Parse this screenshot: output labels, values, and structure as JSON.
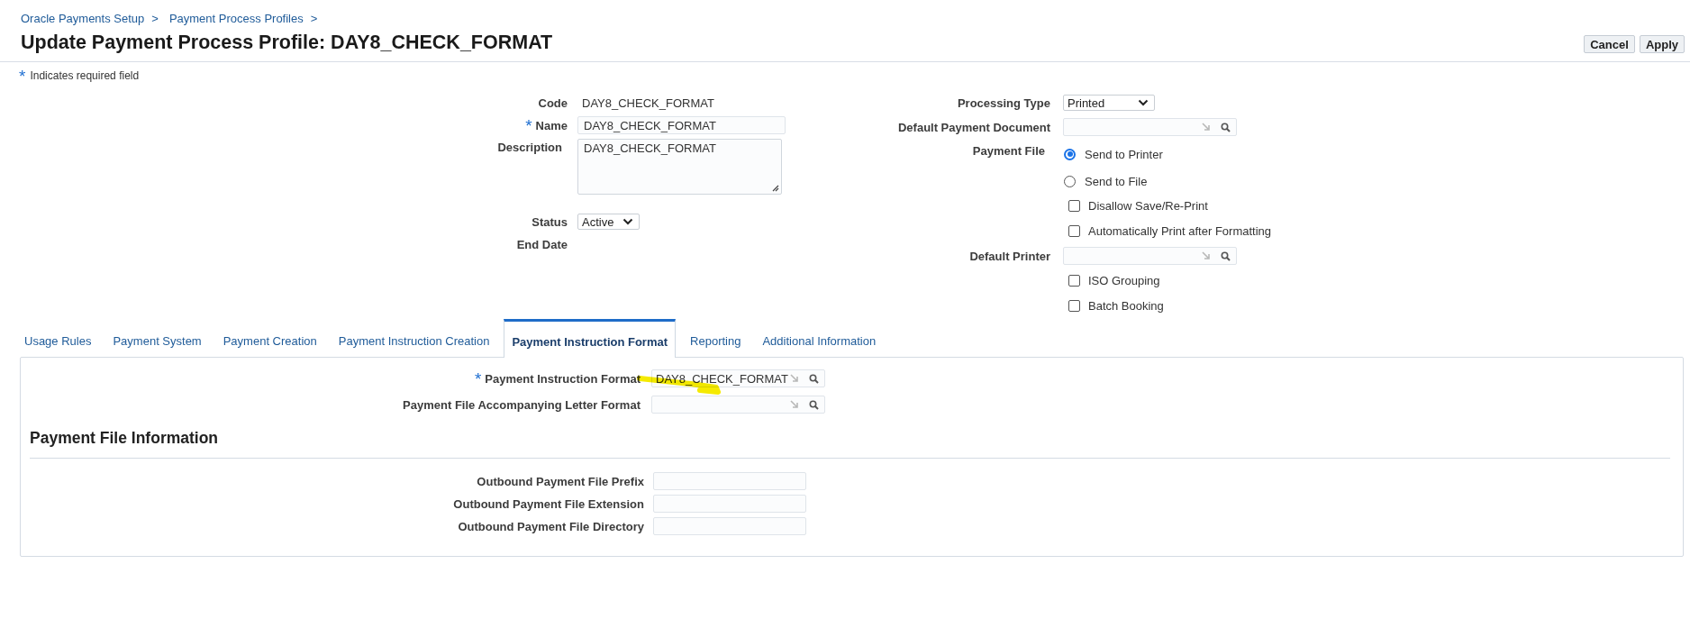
{
  "breadcrumbs": {
    "separator": ">",
    "items": [
      "Oracle Payments Setup",
      "Payment Process Profiles"
    ]
  },
  "title": "Update Payment Process Profile: DAY8_CHECK_FORMAT",
  "buttons": [
    "Cancel",
    "Apply"
  ],
  "required_note": {
    "mark": "*",
    "text": "Indicates required field"
  },
  "left_fields": [
    {
      "kind": "text",
      "label": "Code",
      "value": "DAY8_CHECK_FORMAT"
    },
    {
      "kind": "input",
      "label": "Name",
      "mark": "*",
      "value": "DAY8_CHECK_FORMAT"
    },
    {
      "kind": "textarea",
      "label": "Description",
      "value": "DAY8_CHECK_FORMAT"
    },
    {
      "kind": "select",
      "label": "Status",
      "value": "Active"
    },
    {
      "kind": "text",
      "label": "End Date"
    }
  ],
  "right_fields": [
    {
      "kind": "select",
      "label": "Processing Type",
      "value": "Printed"
    },
    {
      "kind": "lov",
      "label": "Default Payment Document"
    },
    {
      "kind": "radio",
      "label": "Payment File",
      "options": [
        {
          "label": "Send to Printer",
          "selected": true
        },
        {
          "label": "Send to File",
          "selected": false
        }
      ]
    },
    {
      "kind": "checkbox",
      "label": "Disallow Save/Re-Print",
      "checked": false
    },
    {
      "kind": "checkbox",
      "label": "Automatically Print after Formatting",
      "checked": false
    },
    {
      "kind": "lov",
      "label": "Default Printer"
    },
    {
      "kind": "checkbox",
      "label": "ISO Grouping",
      "checked": false
    },
    {
      "kind": "checkbox",
      "label": "Batch Booking",
      "checked": false
    }
  ],
  "tabs": [
    {
      "label": "Usage Rules",
      "selected": false
    },
    {
      "label": "Payment System",
      "selected": false
    },
    {
      "label": "Payment Creation",
      "selected": false
    },
    {
      "label": "Payment Instruction Creation",
      "selected": false
    },
    {
      "label": "Payment Instruction Format",
      "selected": true
    },
    {
      "label": "Reporting",
      "selected": false
    },
    {
      "label": "Additional Information",
      "selected": false
    }
  ],
  "tab_panel": {
    "fields": [
      {
        "kind": "lov",
        "label": "Payment Instruction Format",
        "mark": "*",
        "value": "DAY8_CHECK_FORMAT",
        "highlighted": true
      },
      {
        "kind": "lov",
        "label": "Payment File Accompanying Letter Format"
      }
    ],
    "section": {
      "heading": "Payment File Information",
      "fields": [
        {
          "kind": "input",
          "label": "Outbound Payment File Prefix"
        },
        {
          "kind": "input",
          "label": "Outbound Payment File Extension"
        },
        {
          "kind": "input",
          "label": "Outbound Payment File Directory"
        }
      ]
    }
  }
}
